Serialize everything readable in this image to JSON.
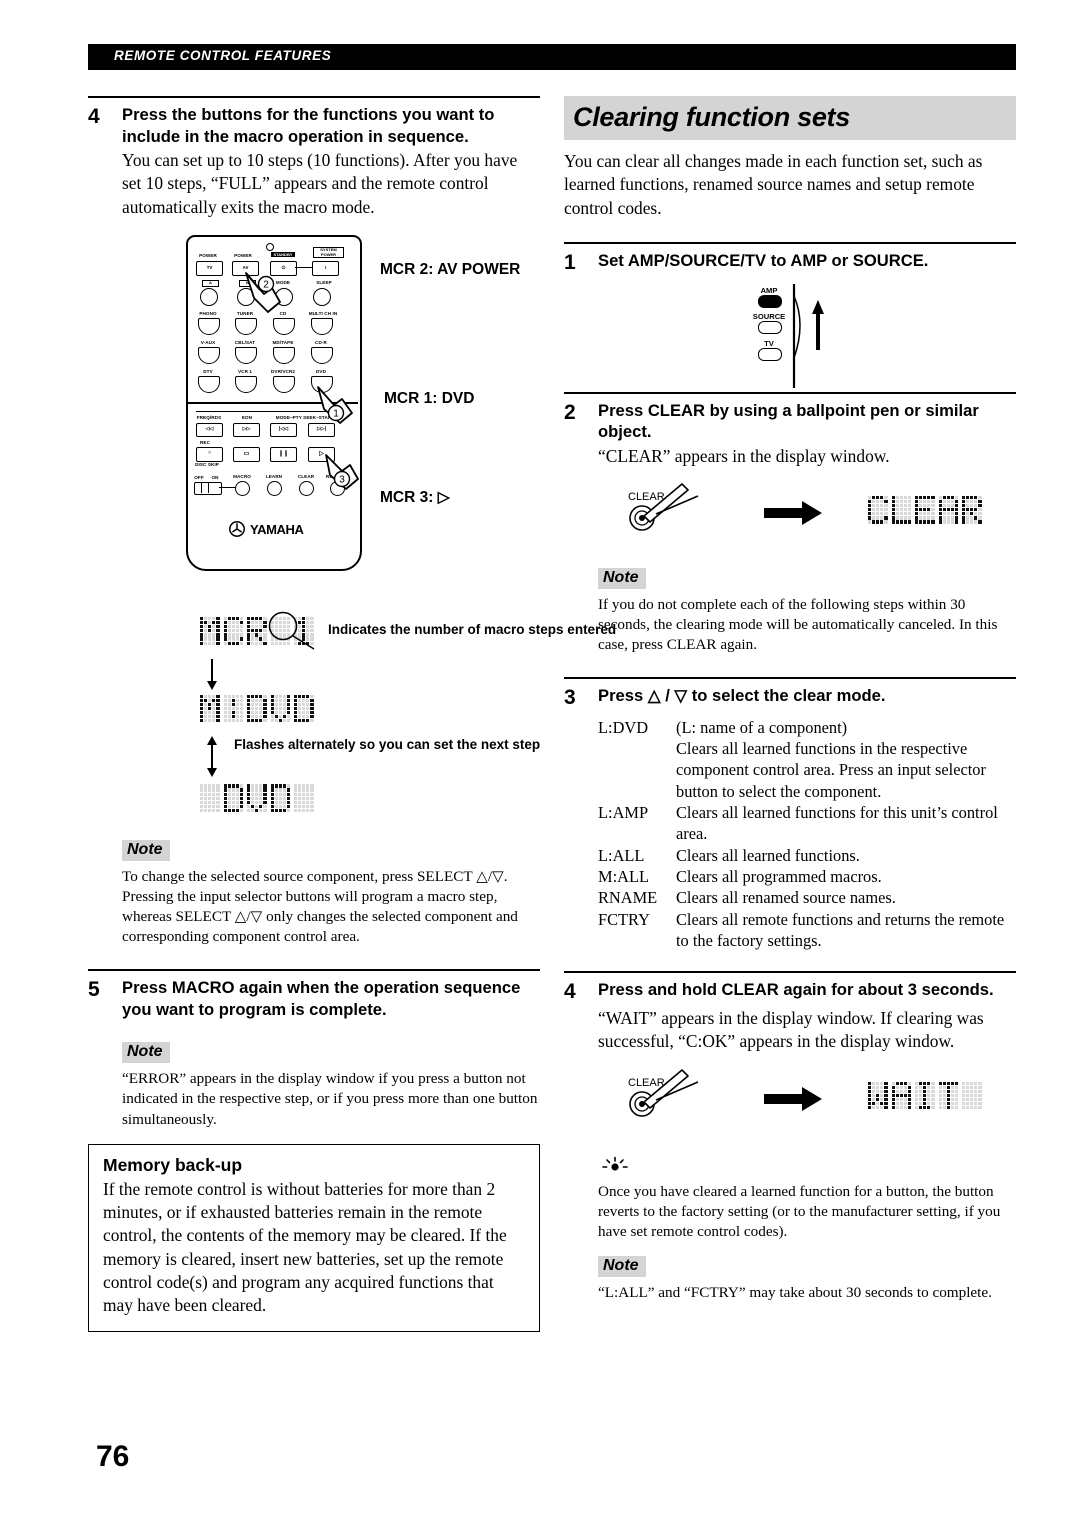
{
  "running_head": "REMOTE CONTROL FEATURES",
  "page_number": "76",
  "left_column": {
    "step4": {
      "num": "4",
      "title": "Press the buttons for the functions you want to include in the macro operation in sequence.",
      "body": "You can set up to 10 steps (10 functions). After you have set 10 steps, “FULL” appears and the remote control automatically exits the macro mode."
    },
    "remote_diagram": {
      "callouts": {
        "mcr2": "MCR 2: AV POWER",
        "mcr1": "MCR 1: DVD",
        "mcr3": "MCR 3: ▷"
      },
      "markers": [
        "1",
        "2",
        "3"
      ],
      "brand": "YAMAHA",
      "top_labels": [
        "POWER",
        "POWER",
        "STANDBY",
        "SYSTEM POWER"
      ],
      "top_buttons": [
        "TV",
        "AV",
        "⏻",
        "I"
      ],
      "row_ab": [
        "A",
        "B",
        "MODE",
        "SLEEP"
      ],
      "row_inputs1": [
        "PHONO",
        "TUNER",
        "CD",
        "MULTI CH IN"
      ],
      "row_inputs2": [
        "V-AUX",
        "CBL/SAT",
        "MD/TAPE",
        "CD-R"
      ],
      "row_inputs3": [
        "DTV",
        "VCR 1",
        "DVR/VCR2",
        "DVD"
      ],
      "lower_labels": [
        "FREQ/RDS",
        "EON",
        "MODE–PTY SEEK–START"
      ],
      "rec_label": "REC",
      "disc_skip_label": "DISC SKIP",
      "switch_off": "OFF",
      "switch_on": "ON",
      "bottom_buttons": [
        "MACRO",
        "LEARN",
        "CLEAR",
        "RE-NAME"
      ]
    },
    "lcd_sequence": {
      "display1": "MCR 1",
      "display2": "M:DVD",
      "display3": "DVD",
      "caption1": "Indicates the number of macro steps entered",
      "caption2": "Flashes alternately so you can set the next step"
    },
    "note1": {
      "label": "Note",
      "body": "To change the selected source component, press SELECT △/▽. Pressing the input selector buttons will program a macro step, whereas SELECT △/▽ only changes the selected component and corresponding component control area."
    },
    "step5": {
      "num": "5",
      "title": "Press MACRO again when the operation sequence you want to program is complete."
    },
    "note2": {
      "label": "Note",
      "body": "“ERROR” appears in the display window if you press a button not indicated in the respective step, or if you press more than one button simultaneously."
    },
    "memory_backup": {
      "heading": "Memory back-up",
      "body": "If the remote control is without batteries for more than 2 minutes, or if exhausted batteries remain in the remote control, the contents of the memory may be cleared. If the memory is cleared, insert new batteries, set up the remote control code(s) and program any acquired functions that may have been cleared."
    }
  },
  "right_column": {
    "section_title": "Clearing function sets",
    "intro": "You can clear all changes made in each function set, such as learned functions, renamed source names and setup remote control codes.",
    "step1": {
      "num": "1",
      "title": "Set AMP/SOURCE/TV to AMP or SOURCE.",
      "switch": {
        "options": [
          "AMP",
          "SOURCE",
          "TV"
        ],
        "selected": "AMP"
      }
    },
    "step2": {
      "num": "2",
      "title": "Press CLEAR by using a ballpoint pen or similar object.",
      "body": "“CLEAR” appears in the display window.",
      "button_label": "CLEAR",
      "display": "CLEAR"
    },
    "note1": {
      "label": "Note",
      "body": "If you do not complete each of the following steps within 30 seconds, the clearing mode will be automatically canceled. In this case, press CLEAR again."
    },
    "step3": {
      "num": "3",
      "title": "Press △ / ▽ to select the clear mode.",
      "modes": [
        {
          "term": "L:DVD",
          "def": "(L: name of a component)",
          "cont": "Clears all learned functions in the respective component control area. Press an input selector button to select the component."
        },
        {
          "term": "L:AMP",
          "def": "Clears all learned functions for this unit’s control",
          "cont": "area."
        },
        {
          "term": "L:ALL",
          "def": "Clears all learned functions.",
          "cont": ""
        },
        {
          "term": "M:ALL",
          "def": "Clears all programmed macros.",
          "cont": ""
        },
        {
          "term": "RNAME",
          "def": "Clears all renamed source names.",
          "cont": ""
        },
        {
          "term": "FCTRY",
          "def": "Clears all remote functions and returns the remote",
          "cont": "to the factory settings."
        }
      ]
    },
    "step4": {
      "num": "4",
      "title": "Press and hold CLEAR again for about 3 seconds.",
      "body": "“WAIT” appears in the display window. If clearing was successful, “C:OK” appears in the display window.",
      "button_label": "CLEAR",
      "display": "WAIT"
    },
    "tip": {
      "body": "Once you have cleared a learned function for a button, the button reverts to the factory setting (or to the manufacturer setting, if you have set remote control codes)."
    },
    "note2": {
      "label": "Note",
      "body": "“L:ALL” and “FCTRY” may take about 30 seconds to complete."
    }
  }
}
